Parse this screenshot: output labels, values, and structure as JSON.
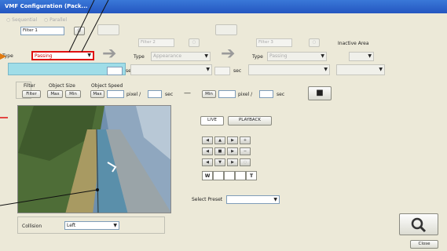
{
  "window": {
    "title": "VMF Configuration (Pack..."
  },
  "top": {
    "radio_sequential": "Sequential",
    "radio_parallel": "Parallel",
    "filters": [
      {
        "name": "Filter 1",
        "type_label": "Type",
        "type_value": "Passing",
        "sec": "sec"
      },
      {
        "name": "Filter 2",
        "type_label": "Type",
        "type_value": "Appearance",
        "sec": "sec"
      },
      {
        "name": "Filter 3",
        "type_label": "Type",
        "type_value": "Passing"
      }
    ],
    "inactive_area_label": "Inactive Area"
  },
  "filter_bar": {
    "filter_label": "Filter",
    "filter_button": "Filter",
    "object_size_label": "Object Size",
    "max_button": "Max",
    "min_button": "Min",
    "object_speed_label": "Object Speed",
    "speed_max_button": "Max",
    "speed_min_button": "Min",
    "pixel_label": "pixel /",
    "sec_label": "sec",
    "dash": "—",
    "pixel_label2": "pixel /",
    "sec_label2": "sec"
  },
  "preview": {
    "collision_label": "Collision",
    "collision_value": "Left"
  },
  "controls": {
    "live_tab": "LIVE",
    "playback_tab": "PLAYBACK",
    "w_label": "W",
    "t_label": "T",
    "select_preset_label": "Select Preset",
    "select_preset_value": ""
  },
  "footer": {
    "close_button": "Close"
  },
  "colors": {
    "titlebar": "#2456c0",
    "highlight_red": "#e01010",
    "accent_cyan": "#9fdde8"
  }
}
